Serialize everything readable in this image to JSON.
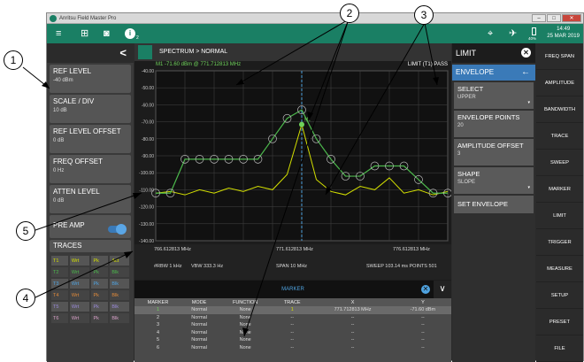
{
  "window": {
    "title": "Anritsu Field Master Pro",
    "btn_min": "–",
    "btn_max": "□",
    "btn_close": "✕"
  },
  "toolbar": {
    "menu_icon": "≡",
    "grid_icon": "⊞",
    "camera_icon": "◙",
    "info_icon": "i",
    "info_sub": "2",
    "time": "14:49",
    "date": "25 MAR 2019",
    "battery": "40%",
    "gps_icon": "⌖",
    "sat_icon": "✈"
  },
  "left_panel": {
    "back_icon": "<",
    "buttons": [
      {
        "label": "REF LEVEL",
        "value": "-40 dBm"
      },
      {
        "label": "SCALE / DIV",
        "value": "10 dB"
      },
      {
        "label": "REF LEVEL OFFSET",
        "value": "0 dB"
      },
      {
        "label": "FREQ OFFSET",
        "value": "0 Hz"
      },
      {
        "label": "ATTEN LEVEL",
        "value": "0 dB"
      }
    ],
    "preamp_label": "PRE AMP",
    "traces_label": "TRACES",
    "traces": [
      [
        "T1",
        "Wrt",
        "Pk",
        "Act"
      ],
      [
        "T2",
        "Wrt",
        "Pk",
        "Blk"
      ],
      [
        "T3",
        "Wrt",
        "Pk",
        "Blk"
      ],
      [
        "T4",
        "Wrt",
        "Pk",
        "Blk"
      ],
      [
        "T5",
        "Wrt",
        "Pk",
        "Blk"
      ],
      [
        "T6",
        "Wrt",
        "Pk",
        "Blk"
      ]
    ]
  },
  "spectrum": {
    "header": "SPECTRUM  >  NORMAL",
    "marker_line": "M1  -71.60 dBm @ 771.712813 MHz",
    "limit_status": "LIMIT  (T1) PASS",
    "freq_labels": [
      "766.612813 MHz",
      "771.612813 MHz",
      "776.612813 MHz"
    ],
    "rbw": "#RBW 1 kHz",
    "vbw": "VBW 333.3 Hz",
    "span": "SPAN 10 MHz",
    "sweep": "SWEEP  103.14 ms  POINTS 501"
  },
  "chart_data": {
    "type": "line",
    "title": "",
    "xlabel": "",
    "ylabel": "",
    "ylim": [
      -140,
      -40
    ],
    "y_ticks": [
      "-40.00",
      "-50.00",
      "-60.00",
      "-70.00",
      "-80.00",
      "-90.00",
      "-100.00",
      "-110.00",
      "-120.00",
      "-130.00",
      "-140.00"
    ],
    "grid": true,
    "x": [
      0,
      5,
      10,
      15,
      20,
      25,
      30,
      35,
      40,
      45,
      50,
      55,
      60,
      65,
      70,
      75,
      80,
      85,
      90,
      95,
      100
    ],
    "series": [
      {
        "color": "#d4e000",
        "values": [
          -112,
          -111,
          -113,
          -110,
          -112,
          -109,
          -111,
          -108,
          -110,
          -101,
          -71.6,
          -104,
          -111,
          -113,
          -108,
          -110,
          -103,
          -112,
          -110,
          -113,
          -111
        ]
      },
      {
        "color": "#4cb84c",
        "values": [
          -112,
          -112,
          -92,
          -92,
          -92,
          -92,
          -92,
          -92,
          -80,
          -68,
          -63,
          -80,
          -92,
          -102,
          -102,
          -96,
          -96,
          -96,
          -104,
          -112,
          -112
        ]
      }
    ],
    "marker": {
      "label": "M1",
      "x": 50,
      "y": -71.6
    }
  },
  "marker_table": {
    "title": "MARKER",
    "close_icon": "✕",
    "collapse_icon": "∨",
    "columns": [
      "MARKER",
      "MODE",
      "FUNCTION",
      "TRACE",
      "X",
      "Y"
    ],
    "rows": [
      [
        "1",
        "Normal",
        "None",
        "1",
        "771.712813 MHz",
        "-71.60 dBm"
      ],
      [
        "2",
        "Normal",
        "None",
        "--",
        "--",
        "--"
      ],
      [
        "3",
        "Normal",
        "None",
        "--",
        "--",
        "--"
      ],
      [
        "4",
        "Normal",
        "None",
        "--",
        "--",
        "--"
      ],
      [
        "5",
        "Normal",
        "None",
        "--",
        "--",
        "--"
      ],
      [
        "6",
        "Normal",
        "None",
        "--",
        "--",
        "--"
      ]
    ]
  },
  "limit_panel": {
    "title": "LIMIT",
    "close_icon": "✕",
    "envelope_label": "ENVELOPE",
    "back_icon": "←",
    "buttons": [
      {
        "label": "SELECT",
        "value": "UPPER",
        "dropdown": "▾"
      },
      {
        "label": "ENVELOPE POINTS",
        "value": "20"
      },
      {
        "label": "AMPLITUDE OFFSET",
        "value": "3"
      },
      {
        "label": "SHAPE",
        "value": "SLOPE",
        "dropdown": "▾"
      },
      {
        "label": "SET ENVELOPE",
        "value": ""
      }
    ]
  },
  "right_menu": [
    "FREQ SPAN",
    "AMPLITUDE",
    "BANDWIDTH",
    "TRACE",
    "SWEEP",
    "MARKER",
    "LIMIT",
    "TRIGGER",
    "MEASURE",
    "SETUP",
    "PRESET",
    "FILE"
  ],
  "callouts": [
    "1",
    "2",
    "3",
    "4",
    "5"
  ]
}
